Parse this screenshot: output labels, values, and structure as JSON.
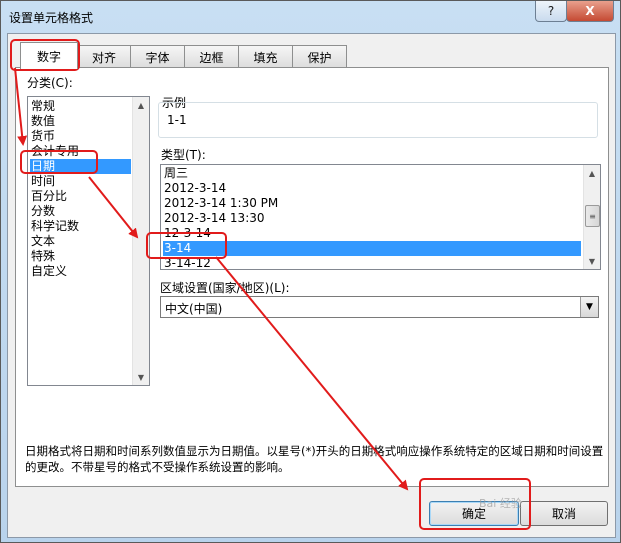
{
  "window": {
    "title": "设置单元格格式",
    "help_label": "?",
    "close_label": "X"
  },
  "tabs": [
    {
      "label": "数字",
      "active": true
    },
    {
      "label": "对齐"
    },
    {
      "label": "字体"
    },
    {
      "label": "边框"
    },
    {
      "label": "填充"
    },
    {
      "label": "保护"
    }
  ],
  "category": {
    "label": "分类(C):",
    "items": [
      "常规",
      "数值",
      "货币",
      "会计专用",
      "日期",
      "时间",
      "百分比",
      "分数",
      "科学记数",
      "文本",
      "特殊",
      "自定义"
    ],
    "selected_index": 4
  },
  "sample": {
    "label": "示例",
    "value": "1-1"
  },
  "type": {
    "label": "类型(T):",
    "items": [
      "周三",
      "2012-3-14",
      "2012-3-14 1:30 PM",
      "2012-3-14 13:30",
      "12-3-14",
      "3-14",
      "3-14-12"
    ],
    "selected_index": 5
  },
  "locale": {
    "label": "区域设置(国家/地区)(L):",
    "value": "中文(中国)"
  },
  "description": "日期格式将日期和时间系列数值显示为日期值。以星号(*)开头的日期格式响应操作系统特定的区域日期和时间设置的更改。不带星号的格式不受操作系统设置的影响。",
  "buttons": {
    "ok": "确定",
    "cancel": "取消"
  },
  "watermark": "Bai 经验",
  "colors": {
    "annotation": "#e11b1b",
    "selection": "#3399ff"
  },
  "icons": {
    "scroll_up": "triangle-up",
    "scroll_down": "triangle-down",
    "combo": "triangle-down"
  }
}
